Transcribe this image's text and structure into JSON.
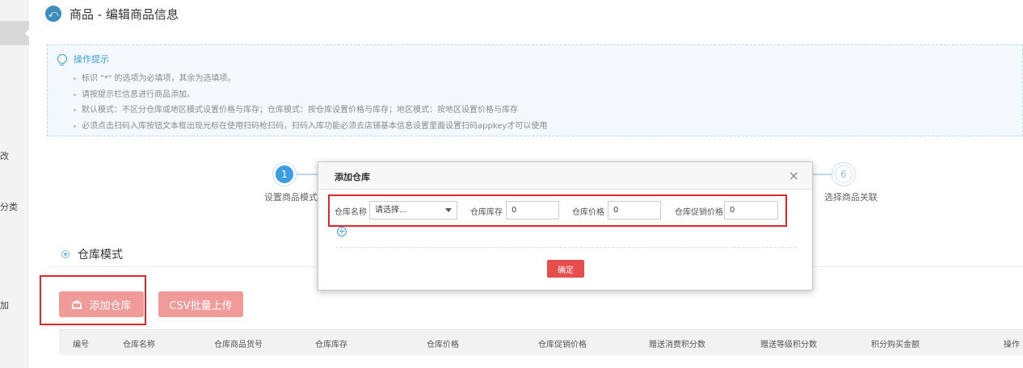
{
  "sidebar": {
    "fragments": [
      "改",
      "分类",
      "加"
    ]
  },
  "header": {
    "title": "商品 - 编辑商品信息"
  },
  "tips": {
    "heading": "操作提示",
    "items": [
      "标识 \"*\" 的选项为必填项，其余为选填项。",
      "请按提示栏信息进行商品添加。",
      "默认模式：不区分仓库或地区模式设置价格与库存；仓库模式：按仓库设置价格与库存；地区模式：按地区设置价格与库存",
      "必须点击扫码入库按钮文本框出现光标在使用扫码枪扫码，扫码入库功能必须去店铺基本信息设置里面设置扫码appkey才可以使用"
    ]
  },
  "steps": [
    {
      "number": "1",
      "label": "设置商品模式"
    },
    {
      "number": "6",
      "label": "选择商品关联"
    }
  ],
  "section": {
    "title": "仓库模式",
    "add_warehouse_label": "添加仓库",
    "csv_upload_label": "CSV批量上传"
  },
  "table": {
    "columns": [
      "编号",
      "仓库名称",
      "仓库商品货号",
      "仓库库存",
      "仓库价格",
      "仓库促销价格",
      "赠送消费积分数",
      "赠送等级积分数",
      "积分购买金额",
      "操作"
    ]
  },
  "modal": {
    "title": "添加仓库",
    "close_icon": "×",
    "warehouse_name_label": "仓库名称",
    "warehouse_name_value": "请选择...",
    "stock_label": "仓库库存",
    "stock_value": "0",
    "price_label": "仓库价格",
    "price_value": "0",
    "promo_price_label": "仓库促销价格",
    "promo_price_value": "0",
    "add_row_icon": "+",
    "confirm_label": "确定"
  },
  "colors": {
    "accent": "#3c9ee0",
    "danger": "#e84d4d",
    "pink_button": "#f09a9a",
    "highlight_box": "#e2262b"
  }
}
